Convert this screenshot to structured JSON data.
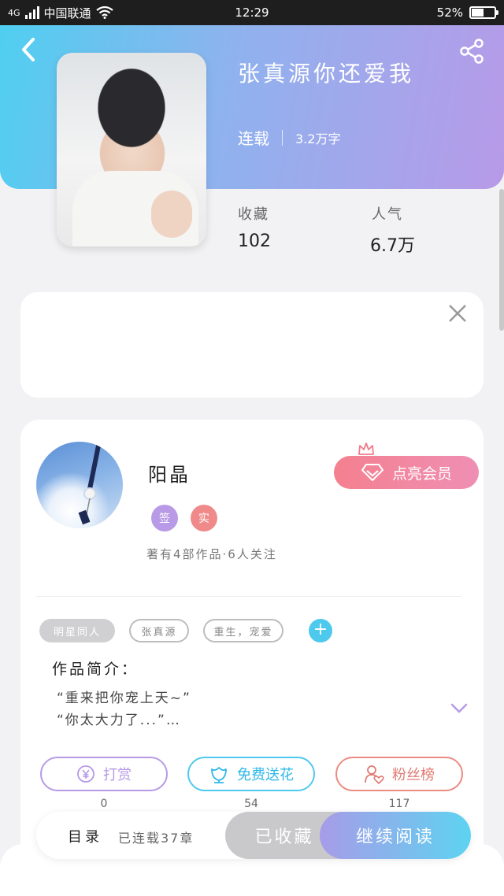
{
  "status_bar": {
    "network": "4G",
    "carrier": "中国联通",
    "time": "12:29",
    "battery": "52%",
    "battery_level": 0.52
  },
  "book": {
    "title": "张真源你还爱我",
    "status": "连载",
    "word_count": "3.2万字",
    "collect_label": "收藏",
    "collect_value": "102",
    "popularity_label": "人气",
    "popularity_value": "6.7万"
  },
  "author": {
    "name": "阳晶",
    "badge_sign": "签",
    "badge_real": "实",
    "info": "著有4部作品·6人关注",
    "vip_label": "点亮会员"
  },
  "tags": [
    "明星同人",
    "张真源",
    "重生，宠爱"
  ],
  "intro": {
    "title": "作品简介：",
    "text": "“重来把你宠上天~”\n“你太大力了...”…"
  },
  "actions": [
    {
      "label": "打赏",
      "count": "0",
      "color": "#b69ae6"
    },
    {
      "label": "免费送花",
      "count": "54",
      "color": "#4ec9ee"
    },
    {
      "label": "粉丝榜",
      "count": "117",
      "color": "#ea8b82"
    }
  ],
  "bottom_bar": {
    "toc_label": "目录",
    "chapters": "已连载37章",
    "collected_label": "已收藏",
    "continue_label": "继续阅读"
  },
  "colors": {
    "header_start": "#4fcff0",
    "header_end": "#b79ae8",
    "badge_sign": "#b89ae6",
    "badge_real": "#f08a8a"
  }
}
